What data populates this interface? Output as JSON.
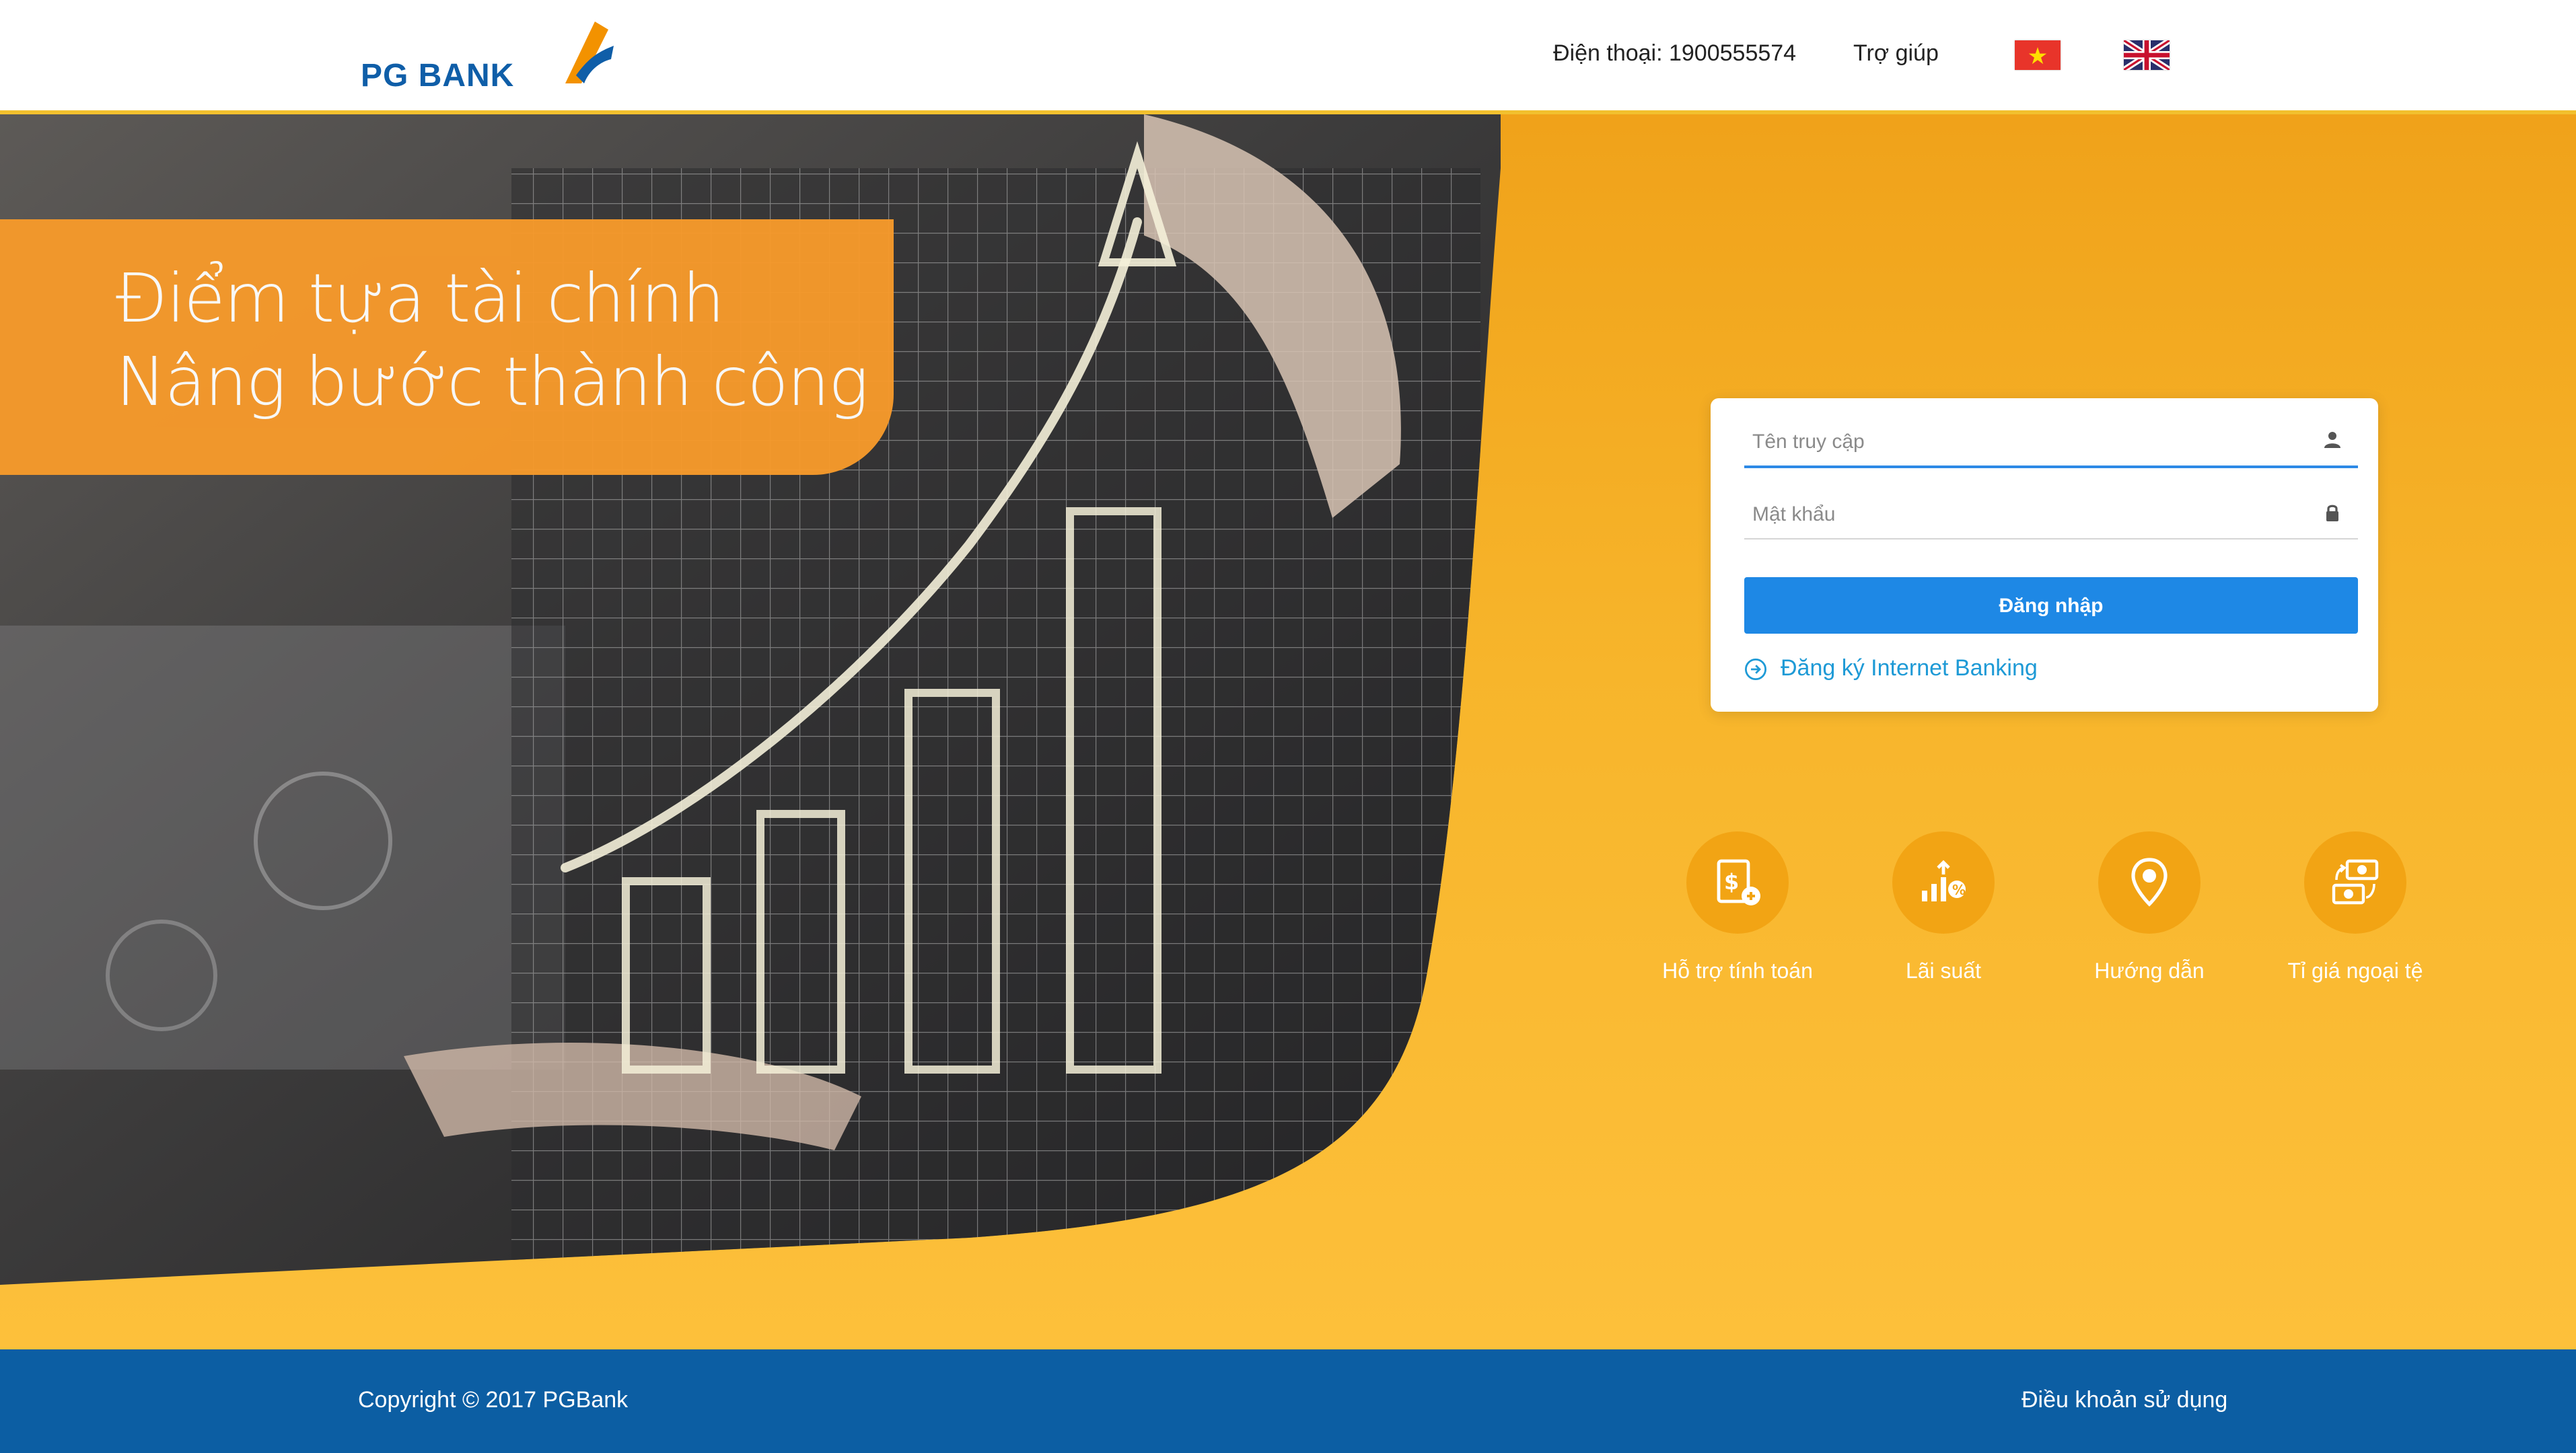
{
  "brand": {
    "name": "PG BANK",
    "logo_colors": {
      "text": "#0f5ea8",
      "orange": "#f39200",
      "blue": "#0f5ea8"
    }
  },
  "header": {
    "phone": "Điện thoại: 1900555574",
    "help": "Trợ giúp",
    "languages": [
      {
        "code": "vi",
        "icon": "vietnam-flag-icon"
      },
      {
        "code": "en",
        "icon": "uk-flag-icon"
      }
    ]
  },
  "hero": {
    "tagline_line1": "Điểm tựa tài chính",
    "tagline_line2": "Nâng bước thành công",
    "background_colors": [
      "#f0a21a",
      "#fdc03b"
    ]
  },
  "login": {
    "username_placeholder": "Tên truy cập",
    "username_value": "",
    "username_icon": "user-icon",
    "password_placeholder": "Mật khẩu",
    "password_value": "",
    "password_icon": "lock-icon",
    "submit_label": "Đăng nhập",
    "register_label": "Đăng ký Internet Banking",
    "accent_color": "#1e88e5"
  },
  "quick_links": [
    {
      "label": "Hỗ trợ tính toán",
      "icon": "calculator-icon"
    },
    {
      "label": "Lãi suất",
      "icon": "interest-rate-icon"
    },
    {
      "label": "Hướng dẫn",
      "icon": "location-pin-icon"
    },
    {
      "label": "Tỉ giá ngoại tệ",
      "icon": "currency-exchange-icon"
    }
  ],
  "footer": {
    "copyright": "Copyright © 2017 PGBank",
    "terms": "Điều khoản sử dụng",
    "background_color": "#0c5ea3"
  }
}
